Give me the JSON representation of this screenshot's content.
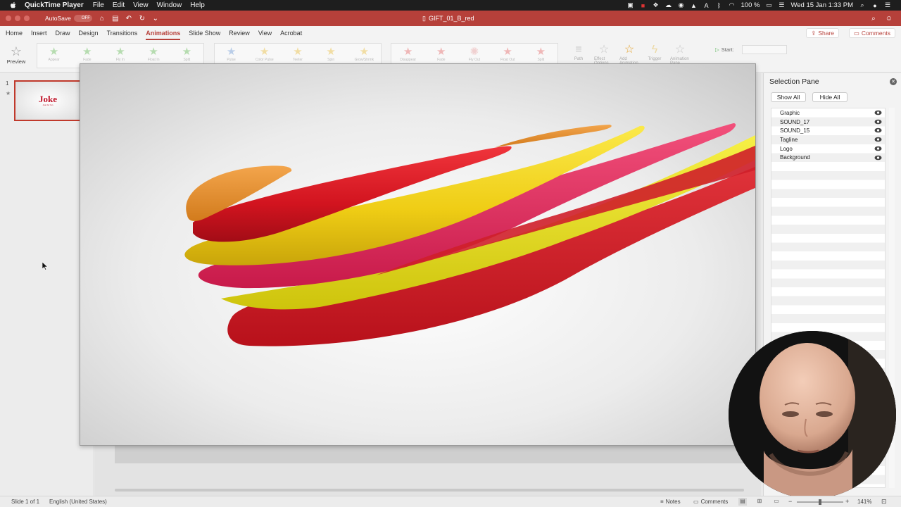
{
  "menubar": {
    "app_name": "QuickTime Player",
    "menus": [
      "File",
      "Edit",
      "View",
      "Window",
      "Help"
    ],
    "battery": "100 %",
    "datetime": "Wed 15 Jan  1:33 PM"
  },
  "titlebar": {
    "autosave_label": "AutoSave",
    "autosave_state": "OFF",
    "document_title": "GIFT_01_B_red"
  },
  "ribbon_tabs": [
    "Home",
    "Insert",
    "Draw",
    "Design",
    "Transitions",
    "Animations",
    "Slide Show",
    "Review",
    "View",
    "Acrobat"
  ],
  "active_tab": "Animations",
  "share_label": "Share",
  "comments_label": "Comments",
  "ribbon": {
    "preview_label": "Preview",
    "entrance_effects": [
      "Appear",
      "Fade",
      "Fly In",
      "Float In",
      "Split"
    ],
    "emphasis_effects": [
      "Pulse",
      "Color Pulse",
      "Teeter",
      "Spin",
      "Grow/Shrink"
    ],
    "exit_effects": [
      "Disappear",
      "Fade",
      "Fly Out",
      "Float Out",
      "Split"
    ],
    "right_buttons": [
      "Path",
      "Effect Options",
      "Add Animation",
      "Trigger",
      "Animation Pane"
    ],
    "start_label": "Start:"
  },
  "thumbnails": {
    "slide_number": "1",
    "logo_text": "Joke",
    "tagline_text": "Just for fun"
  },
  "selection_pane": {
    "title": "Selection Pane",
    "show_all": "Show All",
    "hide_all": "Hide All",
    "layers": [
      "Graphic",
      "SOUND_17",
      "SOUND_15",
      "Tagline",
      "Logo",
      "Background"
    ]
  },
  "statusbar": {
    "slide_count": "Slide 1 of 1",
    "language": "English (United States)",
    "notes": "Notes",
    "comments": "Comments",
    "zoom": "141%"
  },
  "colors": {
    "accent": "#b6403a",
    "ribbon_red": "#e8232f",
    "ribbon_yellow": "#f2d61a",
    "ribbon_orange": "#e8902a",
    "ribbon_pink": "#e02a5e"
  }
}
